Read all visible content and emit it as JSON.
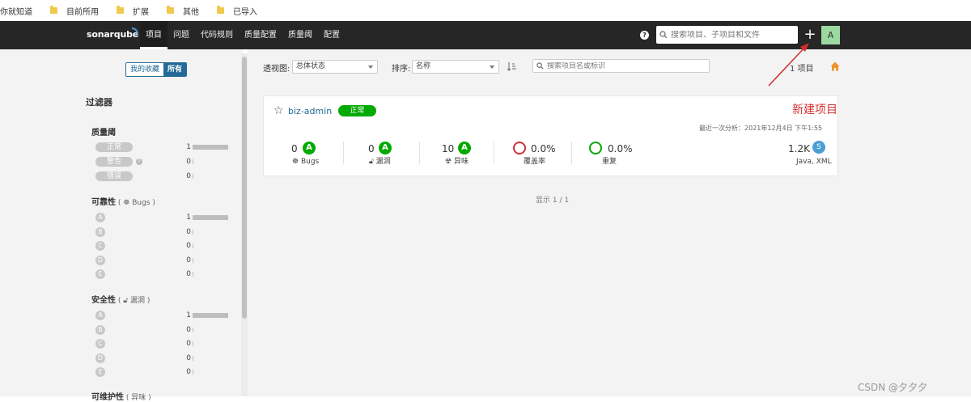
{
  "bookmarks": [
    {
      "label": "你就知道",
      "folder": false
    },
    {
      "label": "目前所用",
      "folder": true
    },
    {
      "label": "扩展",
      "folder": true
    },
    {
      "label": "其他",
      "folder": true
    },
    {
      "label": "已导入",
      "folder": true
    }
  ],
  "nav": {
    "logo": "sonarqube",
    "items": [
      "项目",
      "问题",
      "代码规则",
      "质量配置",
      "质量阈",
      "配置"
    ],
    "search_placeholder": "搜索项目、子项目和文件",
    "plus": "+",
    "avatar": "A",
    "help": "?"
  },
  "sidebar": {
    "toggle_favorites": "我的收藏",
    "toggle_all": "所有",
    "filters_title": "过滤器",
    "quality_gate": {
      "title": "质量阈",
      "rows": [
        {
          "label": "正常",
          "count": "1",
          "fraction": 1
        },
        {
          "label": "警告",
          "count": "0",
          "fraction": 0
        },
        {
          "label": "错误",
          "count": "0",
          "fraction": 0
        }
      ]
    },
    "reliability": {
      "title": "可靠性",
      "sub": "Bugs",
      "rows": [
        {
          "label": "A",
          "count": "1",
          "fraction": 1
        },
        {
          "label": "B",
          "count": "0",
          "fraction": 0
        },
        {
          "label": "C",
          "count": "0",
          "fraction": 0
        },
        {
          "label": "D",
          "count": "0",
          "fraction": 0
        },
        {
          "label": "E",
          "count": "0",
          "fraction": 0
        }
      ]
    },
    "security": {
      "title": "安全性",
      "sub": "漏洞",
      "rows": [
        {
          "label": "A",
          "count": "1",
          "fraction": 1
        },
        {
          "label": "B",
          "count": "0",
          "fraction": 0
        },
        {
          "label": "C",
          "count": "0",
          "fraction": 0
        },
        {
          "label": "D",
          "count": "0",
          "fraction": 0
        },
        {
          "label": "E",
          "count": "0",
          "fraction": 0
        }
      ]
    },
    "maintainability": {
      "title": "可维护性",
      "sub": "异味"
    }
  },
  "toolbar": {
    "view_label": "透视图:",
    "view_value": "总体状态",
    "sort_label": "排序:",
    "sort_value": "名称",
    "search_placeholder": "搜索项目名或标识",
    "count_label": "1 项目"
  },
  "project": {
    "name": "biz-admin",
    "status": "正常",
    "last_analysis": "最近一次分析：2021年12月4日 下午1:55",
    "metrics": {
      "bugs": {
        "value": "0",
        "grade": "A",
        "label": "Bugs"
      },
      "vulnerabilities": {
        "value": "0",
        "grade": "A",
        "label": "漏洞"
      },
      "code_smells": {
        "value": "10",
        "grade": "A",
        "label": "异味"
      },
      "coverage": {
        "value": "0.0%",
        "label": "覆盖率"
      },
      "duplications": {
        "value": "0.0%",
        "label": "重复"
      },
      "size": {
        "value": "1.2K",
        "badge": "S",
        "languages": "Java, XML"
      }
    }
  },
  "pager": "显示 1 / 1",
  "annotation": "新建项目",
  "watermark": "CSDN @夕夕夕",
  "colors": {
    "nav_bg": "#262626",
    "passed": "#00aa00",
    "link": "#236a97",
    "coverage_ring": "#d02f3a",
    "duplication_ring": "#00aa00",
    "size_badge": "#4b9fd5",
    "annotation": "#d32f2f",
    "home_icon": "#f0932b"
  }
}
